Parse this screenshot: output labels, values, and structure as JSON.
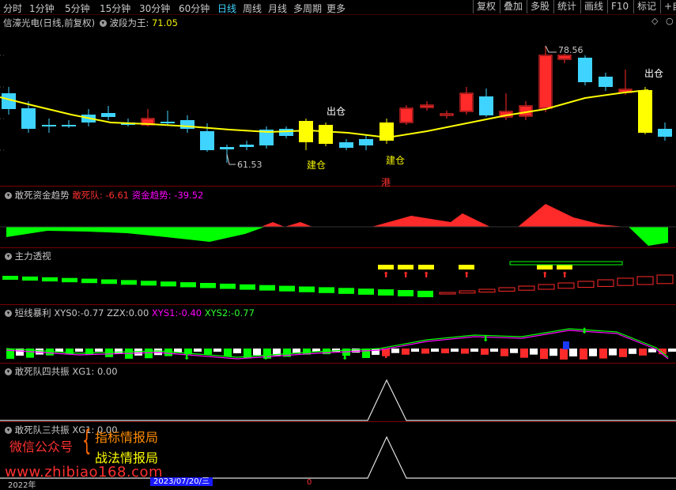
{
  "toolbar": {
    "periods": [
      "分时",
      "1分钟",
      "5分钟",
      "15分钟",
      "30分钟",
      "60分钟",
      "日线",
      "周线",
      "月线",
      "多周期",
      "更多"
    ],
    "active_period": "日线",
    "right_buttons": [
      "复权",
      "叠加",
      "多股",
      "统计",
      "画线",
      "F10",
      "标记",
      "+自"
    ]
  },
  "main_panel": {
    "stock_name": "信濠光电",
    "period_info": "(日线,前复权)",
    "indicator_name": "波段为王",
    "indicator_value": "71.05",
    "high_label": "78.56",
    "low_label": "61.53",
    "signals": [
      "出仓",
      "建仓",
      "建仓",
      "出仓"
    ],
    "hk_label": "港"
  },
  "panel_fund": {
    "title": "敢死资金趋势",
    "v1_label": "敢死队",
    "v1_value": "-6.61",
    "v2_label": "资金趋势",
    "v2_value": "-39.52"
  },
  "panel_main_force": {
    "title": "主力透视"
  },
  "panel_short": {
    "title": "短线暴利",
    "xys0_label": "XYS0:",
    "xys0_value": "-0.77",
    "zzx_label": "ZZX:",
    "zzx_value": "0.00",
    "xys1_label": "XYS1:",
    "xys1_value": "-0.40",
    "xys2_label": "XYS2:",
    "xys2_value": "-0.77"
  },
  "panel_four": {
    "title": "敢死队四共振",
    "xg_label": "XG1:",
    "xg_value": "0.00"
  },
  "panel_three": {
    "title": "敢死队三共振",
    "xg_label": "XG1:",
    "xg_value": "0.00"
  },
  "watermark": {
    "wechat": "微信公众号",
    "line1": "指标情报局",
    "line2": "战法情报局",
    "url": "www.zhibiao168.com"
  },
  "footer": {
    "left_date": "2022年",
    "date_box": "2023/07/20/三",
    "right_value": "0"
  },
  "colors": {
    "up": "#ff2a2a",
    "down": "#3fd3ff",
    "yellow": "#ffff00",
    "green": "#00ff00"
  }
}
